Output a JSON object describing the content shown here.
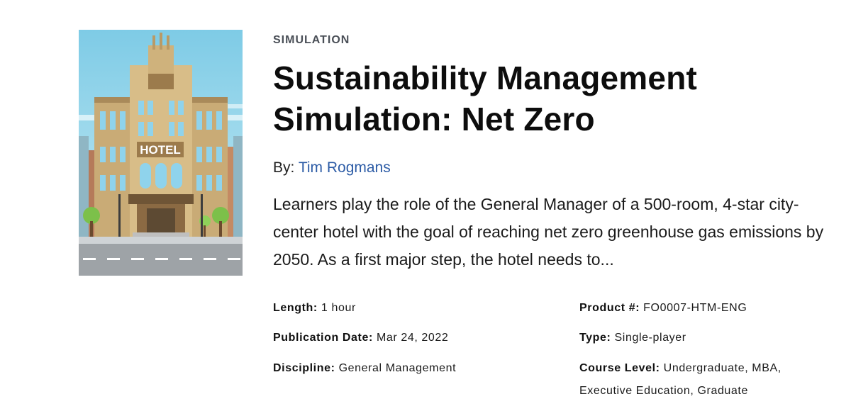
{
  "product": {
    "category": "SIMULATION",
    "title": "Sustainability Management Simulation: Net Zero",
    "by_label": "By:",
    "author": "Tim Rogmans",
    "description": "Learners play the role of the General Manager of a 500-room, 4-star city-center hotel with the goal of reaching net zero greenhouse gas emissions by 2050. As a first major step, the hotel needs to...",
    "cover_sign": "HOTEL"
  },
  "meta": {
    "length": {
      "label": "Length:",
      "value": "1 hour"
    },
    "publication_date": {
      "label": "Publication Date:",
      "value": "Mar 24, 2022"
    },
    "discipline": {
      "label": "Discipline:",
      "value": "General Management"
    },
    "product_number": {
      "label": "Product #:",
      "value": "FO0007-HTM-ENG"
    },
    "type": {
      "label": "Type:",
      "value": "Single-player"
    },
    "course_level": {
      "label": "Course Level:",
      "value": "Undergraduate, MBA, Executive Education, Graduate"
    }
  },
  "colors": {
    "link": "#2d5ca6",
    "eyebrow": "#4a4f57",
    "sky": "#9fd8ea",
    "building": "#cdb07a"
  }
}
